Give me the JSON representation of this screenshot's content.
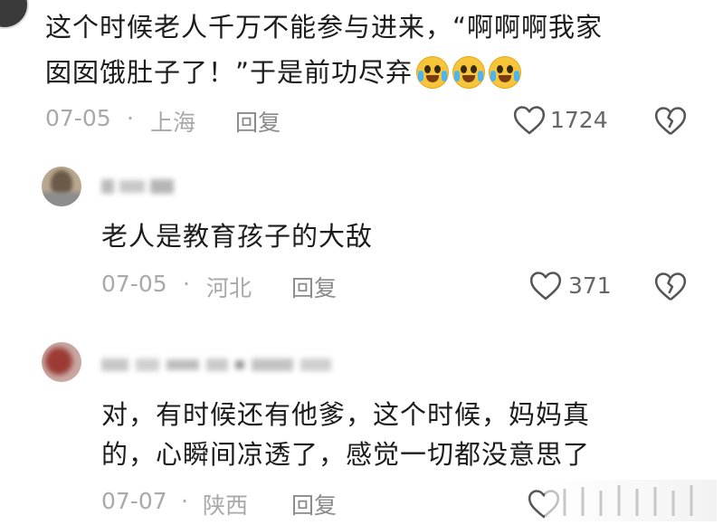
{
  "comment1": {
    "line1": "这个时候老人千万不能参与进来，“啊啊啊我家",
    "line2": "囡囡饿肚子了！”于是前功尽弃",
    "emoji": "crying-laughing-emoji",
    "date": "07-05",
    "separator": "·",
    "location": "上海",
    "reply_label": "回复",
    "like_count": "1724"
  },
  "reply1": {
    "text": "老人是教育孩子的大敌",
    "date": "07-05",
    "separator": "·",
    "location": "河北",
    "reply_label": "回复",
    "like_count": "371"
  },
  "reply2": {
    "line1": "对，有时候还有他爹，这个时候，妈妈真",
    "line2": "的，心瞬间凉透了，感觉一切都没意思了",
    "date": "07-07",
    "separator": "·",
    "location": "陕西",
    "reply_label": "回复"
  },
  "icons": {
    "like": "heart-outline-icon",
    "dislike": "broken-heart-icon"
  },
  "colors": {
    "text": "#1c1c1c",
    "meta": "#a9a9a9",
    "icon": "#666666"
  }
}
